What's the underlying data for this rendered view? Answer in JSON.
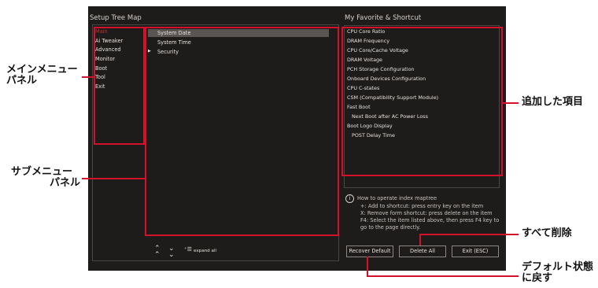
{
  "setup_tree_map": {
    "title": "Setup Tree Map",
    "main_menu": [
      "Main",
      "Ai Tweaker",
      "Advanced",
      "Monitor",
      "Boot",
      "Tool",
      "Exit"
    ],
    "sub_menu": [
      {
        "label": "System Date",
        "arrow": ""
      },
      {
        "label": "System Time",
        "arrow": ""
      },
      {
        "label": "Security",
        "arrow": "▶"
      }
    ],
    "toolbar": {
      "expand_label": "expand all"
    }
  },
  "favorites": {
    "title": "My Favorite & Shortcut",
    "items": [
      "CPU Core Ratio",
      "DRAM Frequency",
      "CPU Core/Cache Voltage",
      "DRAM Voltage",
      "PCH Storage Configuration",
      "Onboard Devices Configuration",
      "CPU C-states",
      "CSM (Compatibility Support Module)",
      "Fast Boot",
      "Next Boot after AC Power Loss",
      "Boot Logo Display",
      "POST Delay Time"
    ]
  },
  "help": {
    "line1": "How to operate index maptree",
    "line2": "+: Add to shortcut: press entry key on the item",
    "line3": "X: Remove form shortcut: press delete on the item",
    "line4": "F4: Select the item listed above, then press F4 key to",
    "line5": "go to the page directly."
  },
  "buttons": {
    "recover_default": "Recover Default",
    "delete_all": "Delete All",
    "exit": "Exit (ESC)"
  },
  "callouts": {
    "main_menu_panel": "メインメニュー\nパネル",
    "sub_menu_panel": "サブメニュー\nパネル",
    "added_items": "追加した項目",
    "delete_all": "すべて削除",
    "restore_default": "デフォルト状態\nに戻す"
  },
  "colors": {
    "background": "#1e1c1b",
    "highlight": "#d4112a",
    "active_menu": "#b5342e"
  }
}
